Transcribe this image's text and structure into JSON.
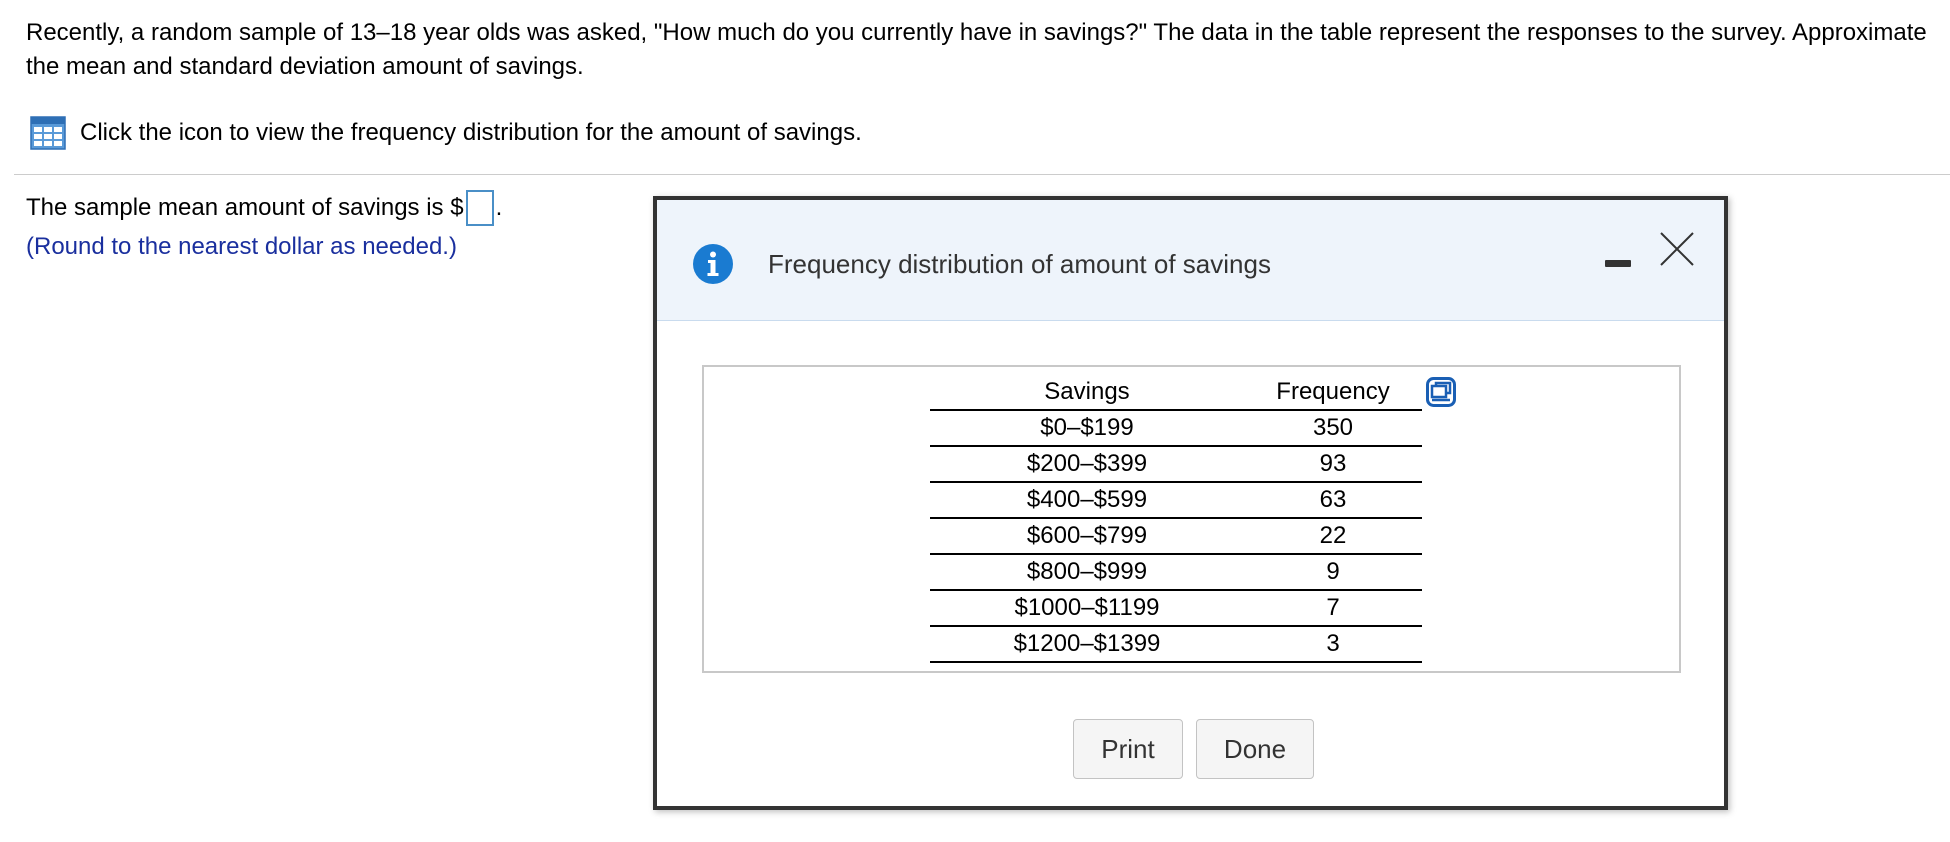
{
  "question": {
    "text": "Recently, a random sample of 13–18 year olds was asked, \"How much do you currently have in savings?\" The data in the table represent the responses to the survey. Approximate the mean and standard deviation amount of savings."
  },
  "icon_prompt": {
    "text": "Click the icon to view the frequency distribution for the amount of savings.",
    "icon": "table-grid-icon"
  },
  "answer": {
    "prefix": "The sample mean amount of savings is $",
    "value": "",
    "suffix": ".",
    "note": "(Round to the nearest dollar as needed.)"
  },
  "modal": {
    "title": "Frequency distribution of amount of savings",
    "info_icon": "info-icon",
    "minimize_icon": "minimize-icon",
    "close_icon": "close-icon",
    "table": {
      "headers": [
        "Savings",
        "Frequency"
      ],
      "rows": [
        [
          "$0–$199",
          "350"
        ],
        [
          "$200–$399",
          "93"
        ],
        [
          "$400–$599",
          "63"
        ],
        [
          "$600–$799",
          "22"
        ],
        [
          "$800–$999",
          "9"
        ],
        [
          "$1000–$1199",
          "7"
        ],
        [
          "$1200–$1399",
          "3"
        ]
      ],
      "copy_icon": "copy-icon"
    },
    "buttons": {
      "print": "Print",
      "done": "Done"
    }
  },
  "colors": {
    "header_bg": "#eef4fb",
    "info_blue": "#1a7bd1",
    "note_blue": "#1a2f9e",
    "answer_border": "#4a8fc7"
  }
}
